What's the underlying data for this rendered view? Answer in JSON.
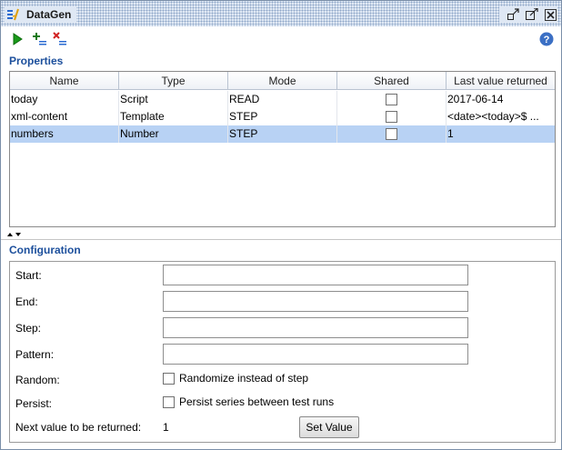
{
  "window": {
    "title": "DataGen"
  },
  "toolbar": {
    "run_icon": "play-icon",
    "add_icon": "add-property-icon",
    "remove_icon": "remove-property-icon",
    "help_icon": "help-icon"
  },
  "properties": {
    "heading": "Properties",
    "columns": [
      "Name",
      "Type",
      "Mode",
      "Shared",
      "Last value returned"
    ],
    "rows": [
      {
        "name": "today",
        "type": "Script",
        "mode": "READ",
        "shared": false,
        "last": "2017-06-14"
      },
      {
        "name": "xml-content",
        "type": "Template",
        "mode": "STEP",
        "shared": false,
        "last": "<date><today>$ ..."
      },
      {
        "name": "numbers",
        "type": "Number",
        "mode": "STEP",
        "shared": false,
        "last": "1"
      }
    ]
  },
  "configuration": {
    "heading": "Configuration",
    "start_label": "Start:",
    "end_label": "End:",
    "step_label": "Step:",
    "pattern_label": "Pattern:",
    "random_label": "Random:",
    "random_checkbox": "Randomize instead of step",
    "persist_label": "Persist:",
    "persist_checkbox": "Persist series between test runs",
    "next_label": "Next value to be returned:",
    "next_value": "1",
    "set_value_button": "Set Value"
  },
  "colors": {
    "accent": "#1c4f9c",
    "selection": "#b8d2f4",
    "titlebar": "#dfe8f4"
  }
}
